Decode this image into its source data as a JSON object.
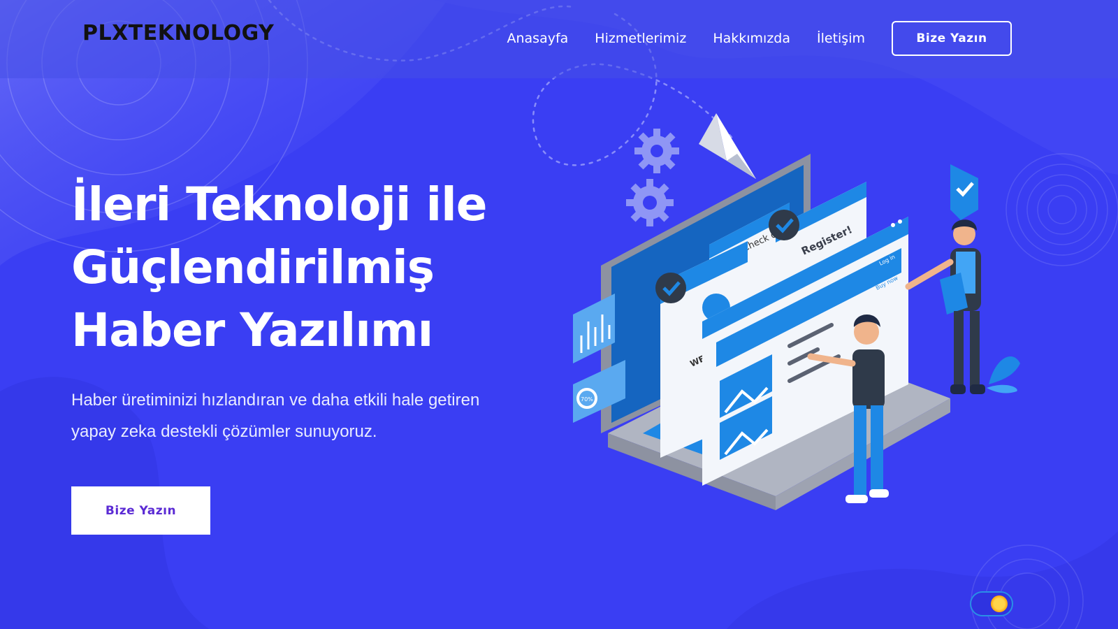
{
  "brand": {
    "logo_text": "PLXTEKNOLOGY"
  },
  "nav": {
    "items": [
      {
        "label": "Anasayfa"
      },
      {
        "label": "Hizmetlerimiz"
      },
      {
        "label": "Hakkımızda"
      },
      {
        "label": "İletişim"
      }
    ],
    "cta_label": "Bize Yazın"
  },
  "hero": {
    "title_lines": [
      "İleri Teknoloji ile",
      "Güçlendirilmiş",
      "Haber Yazılımı"
    ],
    "subtitle": "Haber üretiminizi hızlandıran ve daha etkili hale getiren yapay zeka destekli çözümler sunuyoruz.",
    "cta_label": "Bize Yazın"
  },
  "illustration": {
    "icon_name": "web-development-illustration-icon",
    "screen_texts": {
      "register": "Register!",
      "checkout": "Check out",
      "login": "Log in",
      "buy_now": "Buy now",
      "percent": "70%",
      "welcome": "WE"
    }
  },
  "theme_toggle": {
    "icon_name": "sun-icon",
    "state": "light"
  },
  "colors": {
    "background": "#3a3ef3",
    "header": "#464ee6",
    "cta_text": "#5b2bd4",
    "illustration_blue": "#1e88e5",
    "illustration_light": "#f3f6fb",
    "gear": "#8f96f5"
  }
}
